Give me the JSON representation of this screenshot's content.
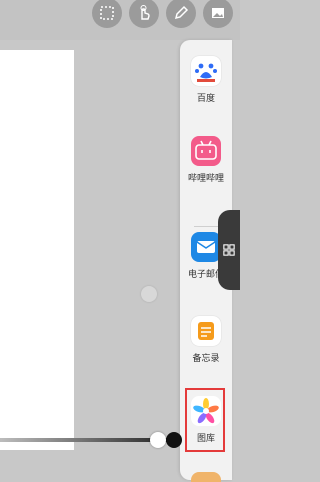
{
  "toolbar": {
    "tools": [
      {
        "icon": "select-rectangle-icon"
      },
      {
        "icon": "hand-pointer-icon"
      },
      {
        "icon": "pencil-icon"
      },
      {
        "icon": "image-icon"
      }
    ]
  },
  "dock": {
    "apps": [
      {
        "label": "百度",
        "icon": "baidu-icon",
        "color": "#2f6cf6"
      },
      {
        "label": "哔哩哔哩",
        "icon": "bilibili-icon",
        "color": "#f35b8a"
      },
      {
        "label": "电子邮件",
        "icon": "email-icon",
        "color": "#1e88e5"
      },
      {
        "label": "备忘录",
        "icon": "memo-icon",
        "color": "#f59b1b"
      },
      {
        "label": "图库",
        "icon": "gallery-icon",
        "color": "#ffffff"
      }
    ],
    "highlight_color": "#e43a3a",
    "handle_icon": "grid-icon"
  }
}
